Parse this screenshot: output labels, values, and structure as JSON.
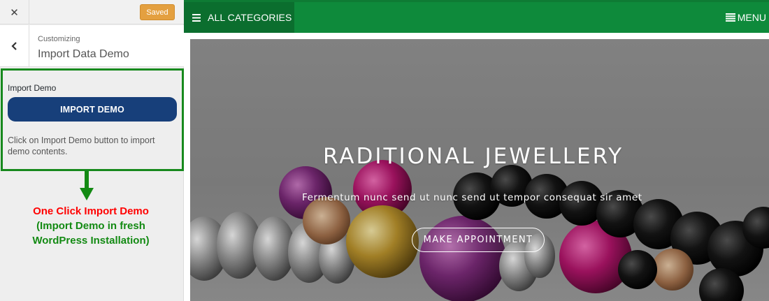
{
  "customizer": {
    "close_label": "✕",
    "saved_label": "Saved",
    "breadcrumb": "Customizing",
    "section_title": "Import Data Demo",
    "field_label": "Import Demo",
    "import_button_label": "IMPORT DEMO",
    "description": "Click on Import Demo button to import demo contents."
  },
  "annotation": {
    "line1": "One Click Import Demo",
    "line2": "(Import Demo in fresh",
    "line3": "WordPress Installation)"
  },
  "preview": {
    "categories_label": "ALL CATEGORIES",
    "menu_label": "MENU",
    "hero_title": "RADITIONAL JEWELLERY",
    "hero_subtitle": "Fermentum nunc send ut nunc send ut tempor consequat sir amet",
    "cta_label": "MAKE APPOINTMENT"
  },
  "colors": {
    "nav_green": "#0e8a3b",
    "highlight_green": "#17891d",
    "import_button_blue": "#173f7a",
    "saved_orange": "#e4a040",
    "annotation_red": "#ff0000"
  },
  "icons": [
    "close-icon",
    "back-chevron-icon",
    "hamburger-icon",
    "arrow-right-icon",
    "arrow-down-icon"
  ]
}
